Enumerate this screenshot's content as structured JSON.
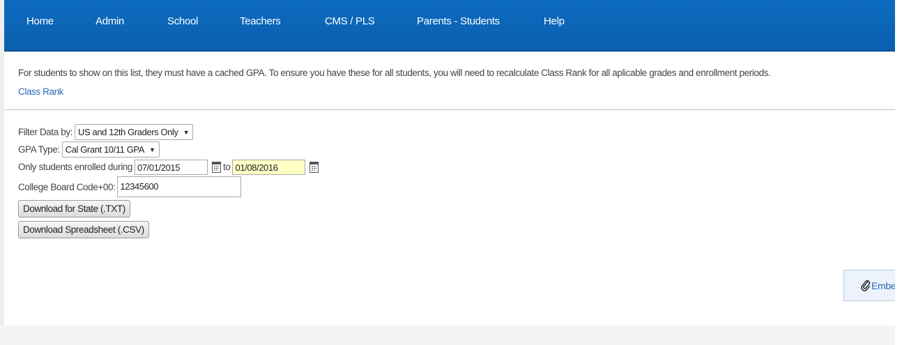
{
  "nav": {
    "items": [
      {
        "label": "Home"
      },
      {
        "label": "Admin"
      },
      {
        "label": "School"
      },
      {
        "label": "Teachers"
      },
      {
        "label": "CMS / PLS"
      },
      {
        "label": "Parents - Students"
      },
      {
        "label": "Help"
      }
    ]
  },
  "notice": {
    "text": "For students to show on this list, they must have a cached GPA. To ensure you have these for all students, you will need to recalculate Class Rank for all aplicable grades and enrollment periods.",
    "link_label": "Class Rank"
  },
  "filters": {
    "filter_label": "Filter Data by:",
    "filter_value": "US and 12th Graders Only",
    "gpa_label": "GPA Type:",
    "gpa_value": "Cal Grant 10/11 GPA",
    "enrolled_label": "Only students enrolled during",
    "start_date": "07/01/2015",
    "to_label": "to",
    "end_date": "01/08/2016",
    "college_label": "College Board Code+00:",
    "college_value": "12345600"
  },
  "actions": {
    "download_state": "Download for State (.TXT)",
    "download_csv": "Download Spreadsheet (.CSV)"
  },
  "embed": {
    "label": "Embe",
    "icon": "paperclip-icon"
  },
  "colors": {
    "nav_bg": "#0b66b8",
    "link": "#2a6ab8",
    "highlight_input": "#ffffc6"
  }
}
